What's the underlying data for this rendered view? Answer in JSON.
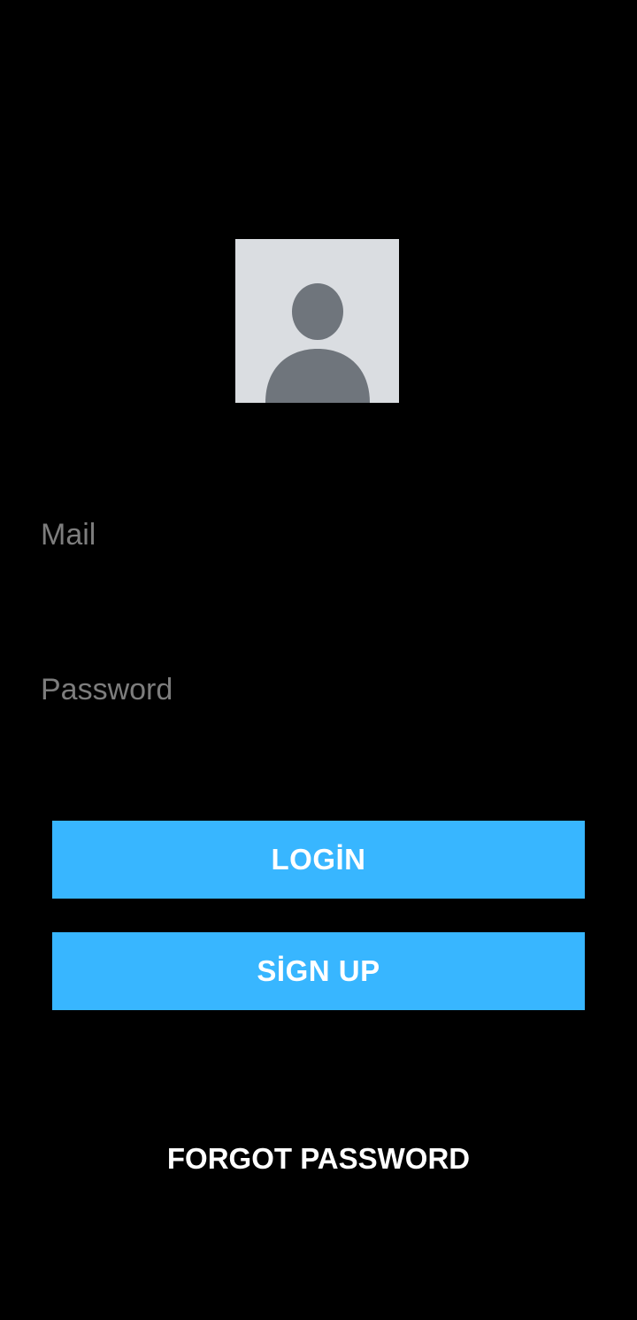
{
  "avatar": {
    "icon": "person-silhouette-icon",
    "background_color": "#dadde1",
    "figure_color": "#6f757c"
  },
  "form": {
    "mail_placeholder": "Mail",
    "mail_value": "",
    "password_placeholder": "Password",
    "password_value": ""
  },
  "buttons": {
    "login_label": "LOGİN",
    "signup_label": "SİGN UP",
    "forgot_label": "FORGOT PASSWORD"
  },
  "colors": {
    "background": "#000000",
    "button_background": "#38b6ff",
    "button_text": "#ffffff",
    "placeholder_text": "#7d7d7d"
  }
}
